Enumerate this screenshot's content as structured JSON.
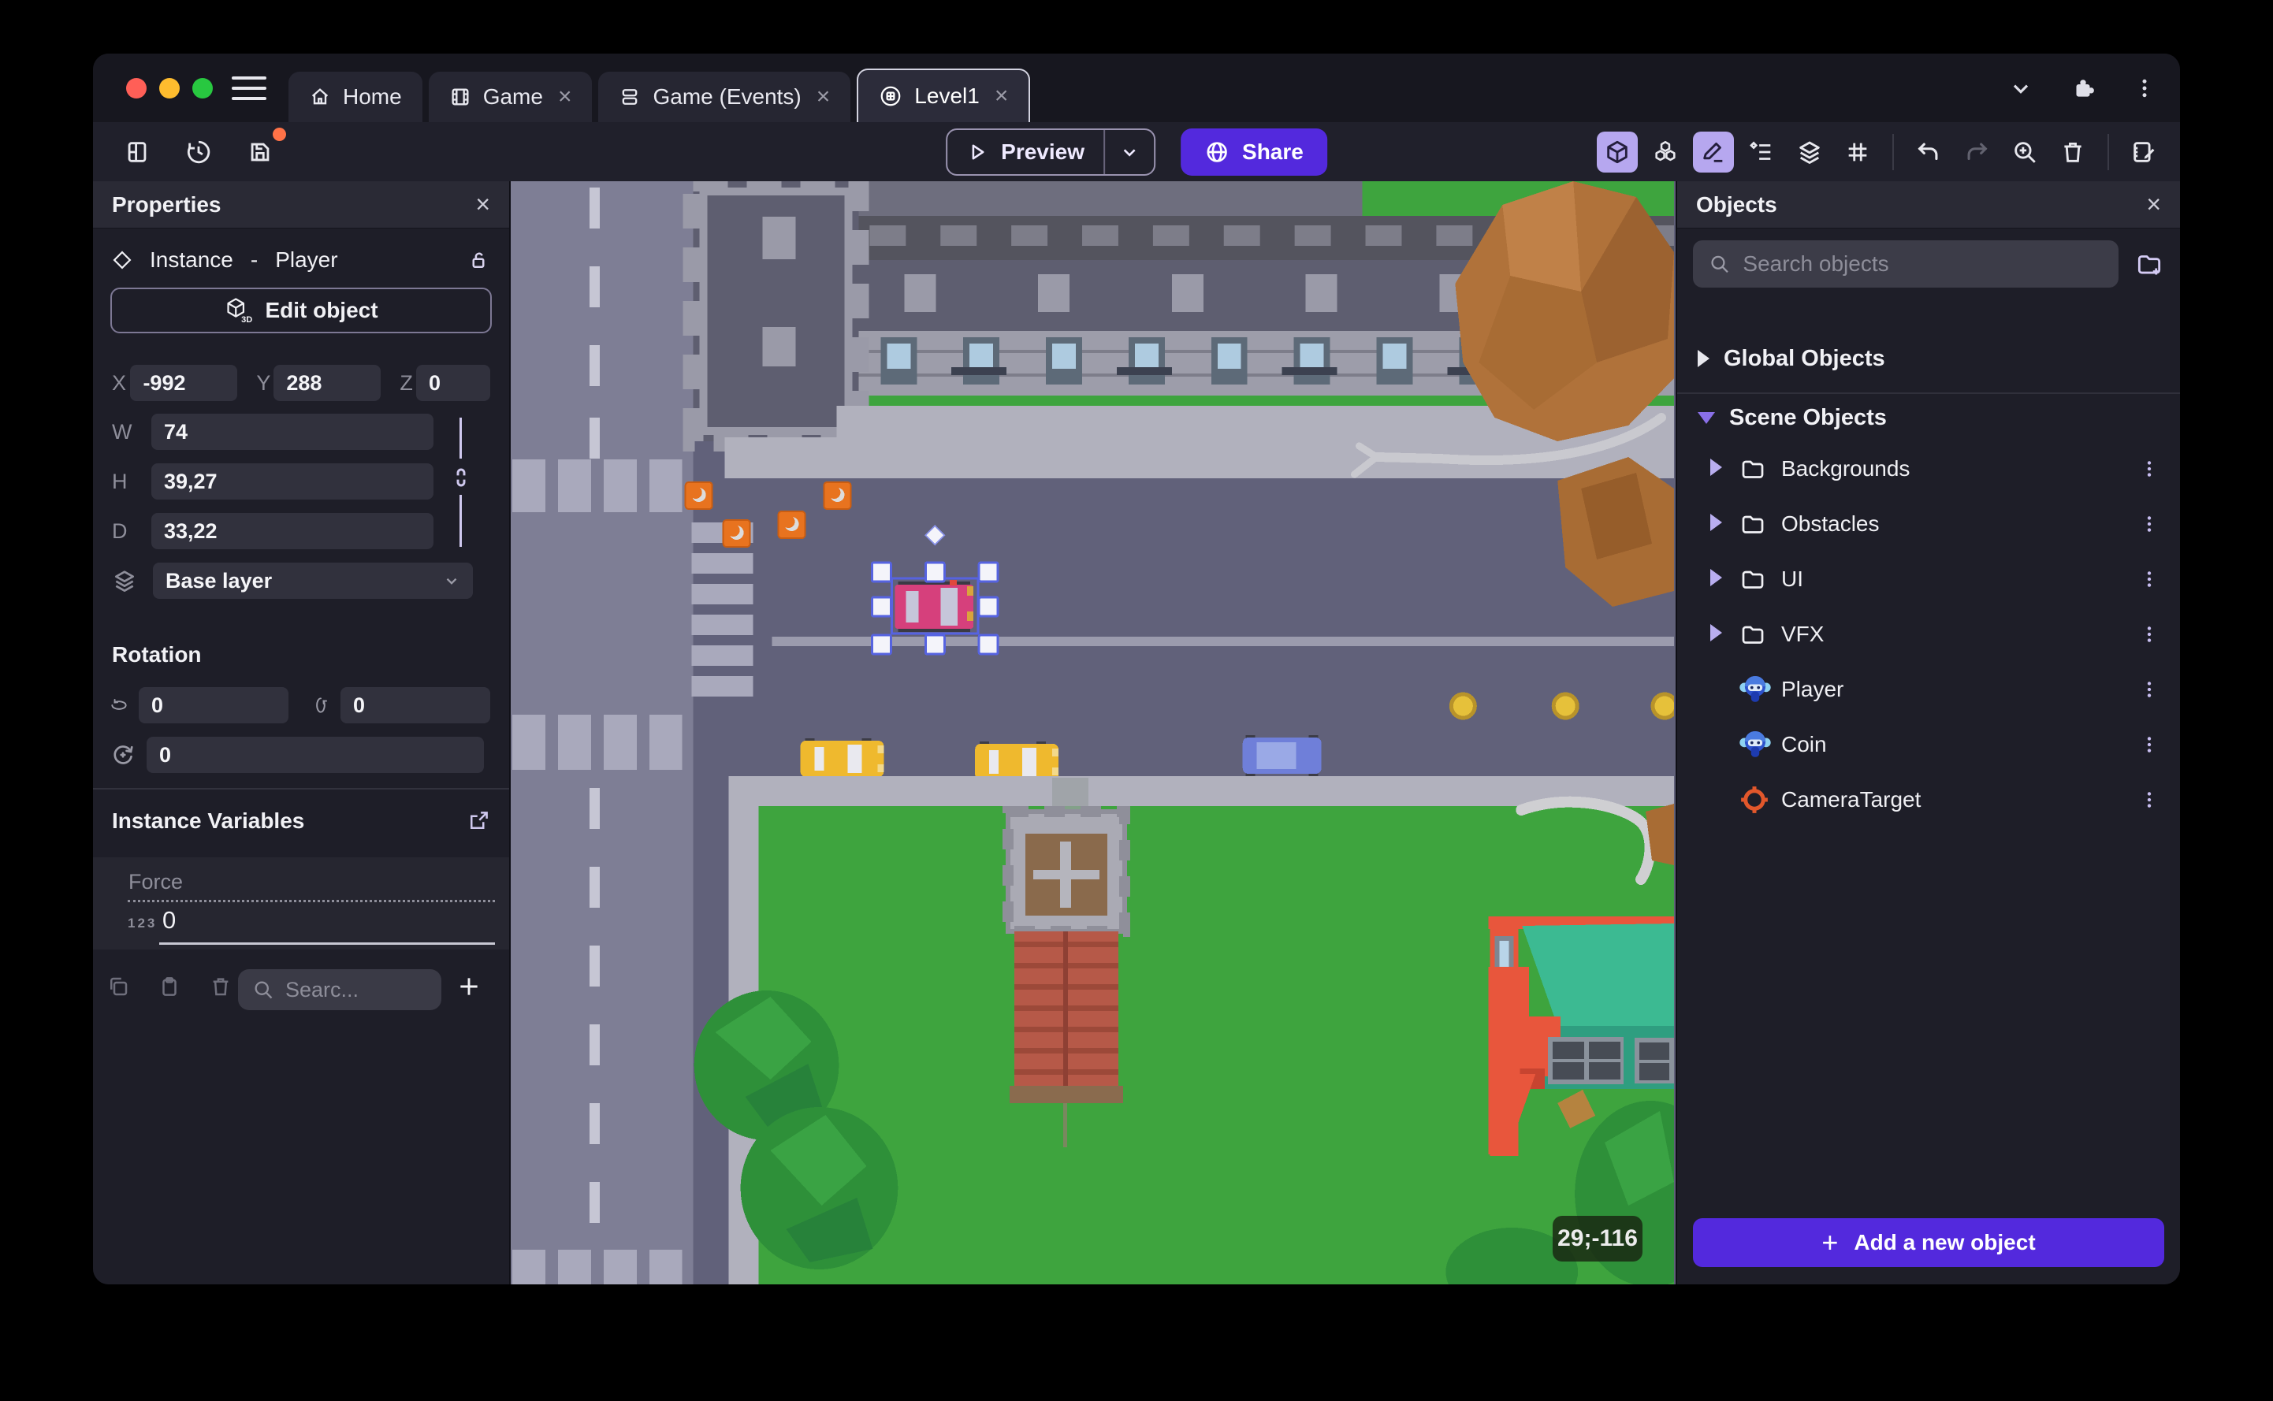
{
  "window": {
    "tabs": [
      {
        "label": "Home",
        "closable": false
      },
      {
        "label": "Game",
        "closable": true
      },
      {
        "label": "Game (Events)",
        "closable": true
      },
      {
        "label": "Level1",
        "closable": true,
        "active": true
      }
    ],
    "close_glyph": "×"
  },
  "toolbar": {
    "preview_label": "Preview",
    "share_label": "Share"
  },
  "properties": {
    "title": "Properties",
    "close_glyph": "×",
    "instance_label": "Instance",
    "separator": "-",
    "object_name": "Player",
    "edit_object_label": "Edit object",
    "edit_object_badge": "3D",
    "position": {
      "x_label": "X",
      "x": "-992",
      "y_label": "Y",
      "y": "288",
      "z_label": "Z",
      "z": "0"
    },
    "size": {
      "w_label": "W",
      "w": "74",
      "h_label": "H",
      "h": "39,27",
      "d_label": "D",
      "d": "33,22"
    },
    "layer_value": "Base layer",
    "rotation_title": "Rotation",
    "rotation": {
      "rx": "0",
      "ry": "0",
      "rz": "0"
    },
    "instance_variables_title": "Instance Variables",
    "variable": {
      "name": "Force",
      "type_badge": "123",
      "value": "0"
    },
    "variables_search_placeholder": "Searc..."
  },
  "objects": {
    "title": "Objects",
    "close_glyph": "×",
    "search_placeholder": "Search objects",
    "global_group_label": "Global Objects",
    "scene_group_label": "Scene Objects",
    "items": [
      {
        "label": "Backgrounds",
        "icon": "folder"
      },
      {
        "label": "Obstacles",
        "icon": "folder"
      },
      {
        "label": "UI",
        "icon": "folder"
      },
      {
        "label": "VFX",
        "icon": "folder"
      },
      {
        "label": "Player",
        "icon": "monkey"
      },
      {
        "label": "Coin",
        "icon": "monkey"
      },
      {
        "label": "CameraTarget",
        "icon": "target"
      }
    ],
    "add_button_label": "Add a new object"
  },
  "canvas": {
    "cursor_coordinates": "29;-116"
  },
  "colors": {
    "accent": "#5329dd",
    "active_tool_bg": "#b6a7ef",
    "selection": "#5663e0",
    "panel_bg": "#1e1e28",
    "canvas_road": "#61617a",
    "grass": "#3ea43e"
  }
}
